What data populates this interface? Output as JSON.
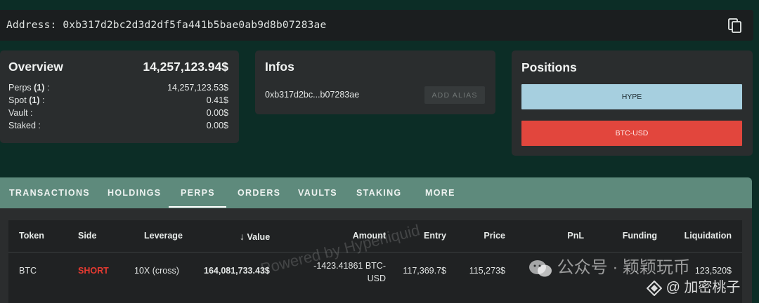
{
  "address_bar": {
    "text": "Address: 0xb317d2bc2d3d2df5fa441b5bae0ab9d8b07283ae"
  },
  "overview": {
    "title": "Overview",
    "total": "14,257,123.94$",
    "rows": [
      {
        "label": "Perps",
        "count": "(1)",
        "suffix": " :",
        "value": "14,257,123.53$"
      },
      {
        "label": "Spot",
        "count": "(1)",
        "suffix": " :",
        "value": "0.41$"
      },
      {
        "label": "Vault",
        "count": "",
        "suffix": " :",
        "value": "0.00$"
      },
      {
        "label": "Staked",
        "count": "",
        "suffix": " :",
        "value": "0.00$"
      }
    ]
  },
  "infos": {
    "title": "Infos",
    "short_address": "0xb317d2bc...b07283ae",
    "add_alias_label": "ADD ALIAS"
  },
  "positions": {
    "title": "Positions",
    "items": [
      {
        "label": "HYPE",
        "color": "#a6cfdf"
      },
      {
        "label": "BTC-USD",
        "color": "#e2463d"
      }
    ]
  },
  "tabs": [
    {
      "label": "TRANSACTIONS"
    },
    {
      "label": "HOLDINGS"
    },
    {
      "label": "PERPS",
      "active": true
    },
    {
      "label": "ORDERS"
    },
    {
      "label": "VAULTS"
    },
    {
      "label": "STAKING"
    },
    {
      "label": "MORE"
    }
  ],
  "table": {
    "headers": {
      "token": "Token",
      "side": "Side",
      "leverage": "Leverage",
      "value": "Value",
      "amount": "Amount",
      "entry": "Entry",
      "price": "Price",
      "pnl": "PnL",
      "funding": "Funding",
      "liquidation": "Liquidation"
    },
    "sort_arrow": "↓",
    "rows": [
      {
        "token": "BTC",
        "side": "SHORT",
        "side_color": "#e53a31",
        "leverage": "10X (cross)",
        "value": "164,081,733.43$",
        "amount_line1": "-1423.41861 BTC-",
        "amount_line2": "USD",
        "entry": "117,369.7$",
        "price": "115,273$",
        "pnl": "",
        "funding": "-",
        "liquidation": "123,520$"
      }
    ]
  },
  "watermark": {
    "table_overlay": "Powered by Hyperliquid",
    "wechat_line1": "公众号 · 颖颖玩币",
    "wechat_line2": "@ 加密桃子"
  }
}
